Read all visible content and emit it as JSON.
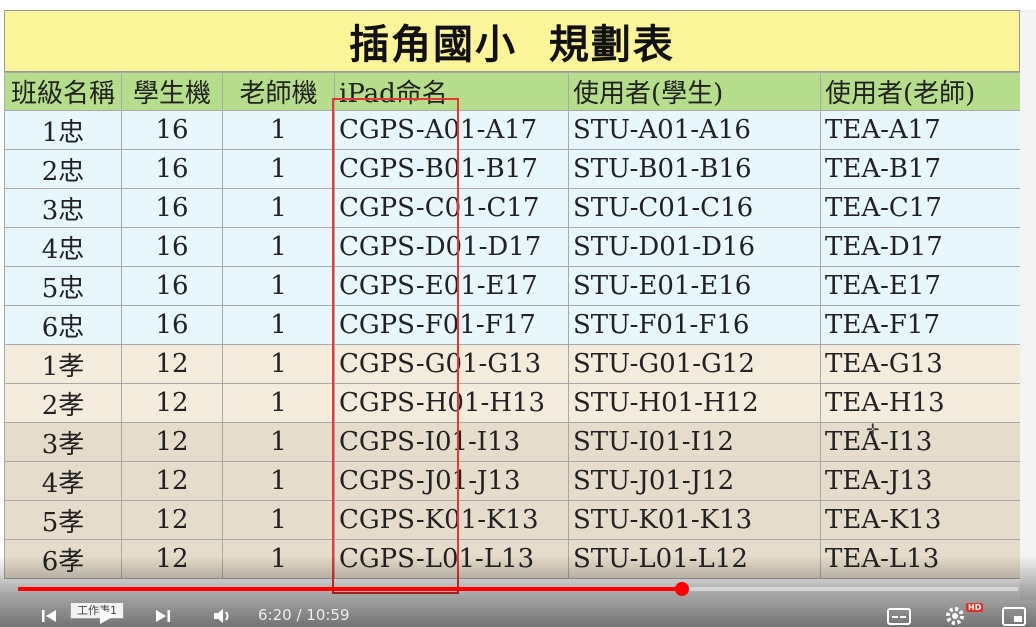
{
  "title": "插角國小  規劃表",
  "headers": [
    "班級名稱",
    "學生機",
    "老師機",
    "iPad命名",
    "使用者(學生)",
    "使用者(老師)"
  ],
  "rows": [
    {
      "cls": "1忠",
      "stu": "16",
      "tea": "1",
      "ipad": "CGPS-A01-A17",
      "user_s": "STU-A01-A16",
      "user_t": "TEA-A17",
      "group": "g-blue"
    },
    {
      "cls": "2忠",
      "stu": "16",
      "tea": "1",
      "ipad": "CGPS-B01-B17",
      "user_s": "STU-B01-B16",
      "user_t": "TEA-B17",
      "group": "g-blue"
    },
    {
      "cls": "3忠",
      "stu": "16",
      "tea": "1",
      "ipad": "CGPS-C01-C17",
      "user_s": "STU-C01-C16",
      "user_t": "TEA-C17",
      "group": "g-blue"
    },
    {
      "cls": "4忠",
      "stu": "16",
      "tea": "1",
      "ipad": "CGPS-D01-D17",
      "user_s": "STU-D01-D16",
      "user_t": "TEA-D17",
      "group": "g-blue"
    },
    {
      "cls": "5忠",
      "stu": "16",
      "tea": "1",
      "ipad": "CGPS-E01-E17",
      "user_s": "STU-E01-E16",
      "user_t": "TEA-E17",
      "group": "g-blue"
    },
    {
      "cls": "6忠",
      "stu": "16",
      "tea": "1",
      "ipad": "CGPS-F01-F17",
      "user_s": "STU-F01-F16",
      "user_t": "TEA-F17",
      "group": "g-blue"
    },
    {
      "cls": "1孝",
      "stu": "12",
      "tea": "1",
      "ipad": "CGPS-G01-G13",
      "user_s": "STU-G01-G12",
      "user_t": "TEA-G13",
      "group": "g-beige"
    },
    {
      "cls": "2孝",
      "stu": "12",
      "tea": "1",
      "ipad": "CGPS-H01-H13",
      "user_s": "STU-H01-H12",
      "user_t": "TEA-H13",
      "group": "g-beige"
    },
    {
      "cls": "3孝",
      "stu": "12",
      "tea": "1",
      "ipad": "CGPS-I01-I13",
      "user_s": "STU-I01-I12",
      "user_t": "TEA-I13",
      "group": "g-tan"
    },
    {
      "cls": "4孝",
      "stu": "12",
      "tea": "1",
      "ipad": "CGPS-J01-J13",
      "user_s": "STU-J01-J12",
      "user_t": "TEA-J13",
      "group": "g-tan"
    },
    {
      "cls": "5孝",
      "stu": "12",
      "tea": "1",
      "ipad": "CGPS-K01-K13",
      "user_s": "STU-K01-K13",
      "user_t": "TEA-K13",
      "group": "g-tan"
    },
    {
      "cls": "6孝",
      "stu": "12",
      "tea": "1",
      "ipad": "CGPS-L01-L13",
      "user_s": "STU-L01-L12",
      "user_t": "TEA-L13",
      "group": "g-tan"
    }
  ],
  "sheet_tab": "工作表1",
  "player": {
    "current_time": "6:20",
    "duration": "10:59",
    "time_display": "6:20 / 10:59",
    "progress_fraction": 0.664,
    "accent_color": "#ff0000",
    "hd_badge": "HD",
    "icons": [
      "previous-icon",
      "play-icon",
      "next-icon",
      "volume-icon",
      "subtitles-icon",
      "settings-icon",
      "miniplayer-icon"
    ]
  }
}
